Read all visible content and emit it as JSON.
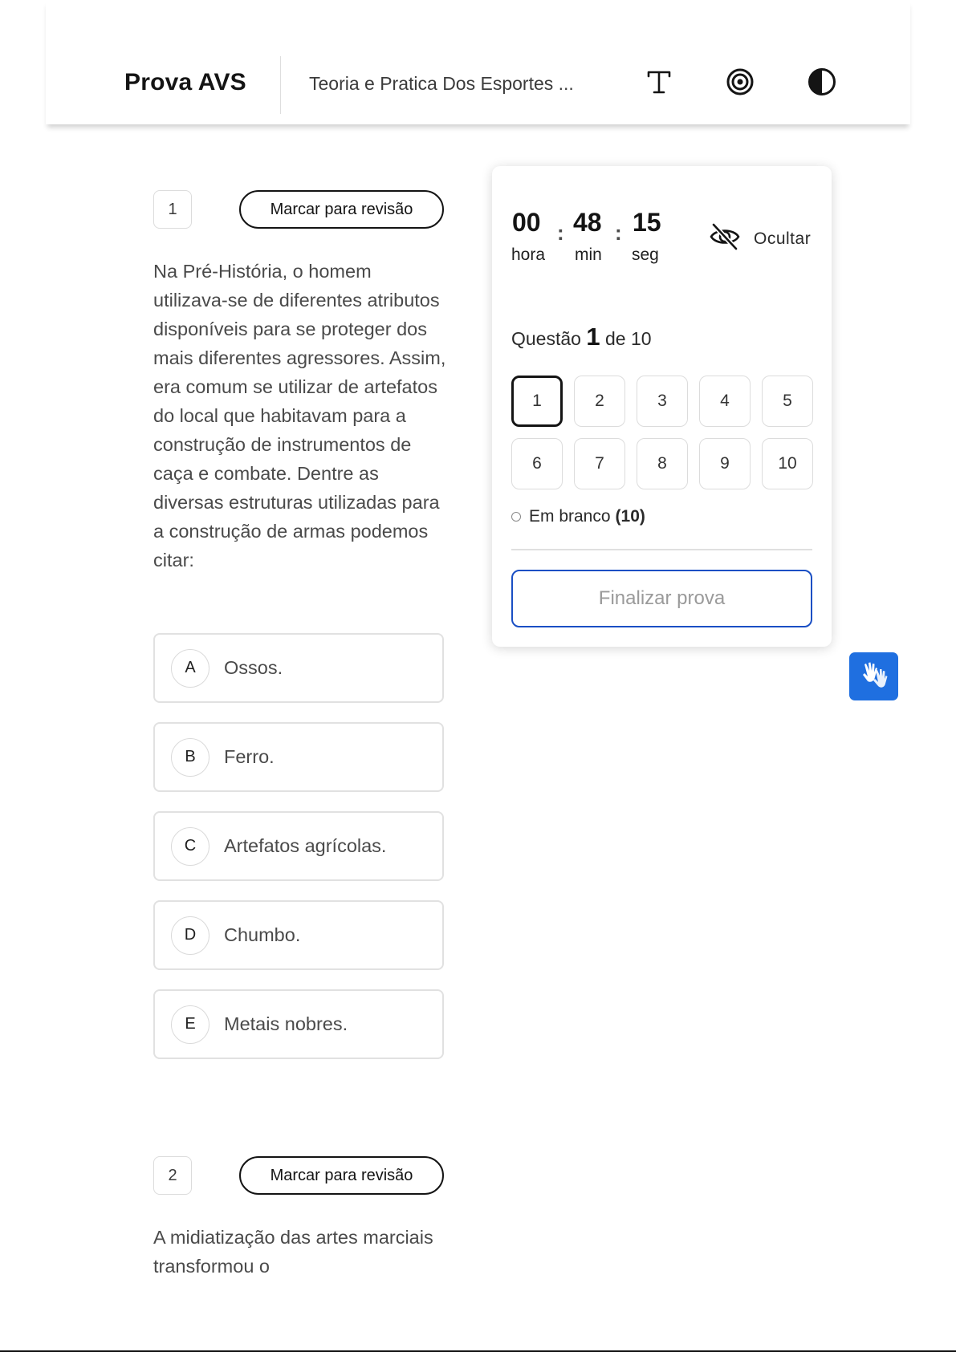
{
  "header": {
    "brand": "Prova AVS",
    "course_title": "Teoria e Pratica Dos Esportes ...",
    "icons": [
      "text-size-icon",
      "focus-target-icon",
      "contrast-icon"
    ]
  },
  "questions": [
    {
      "number": "1",
      "review_label": "Marcar para revisão",
      "text": "Na Pré-História, o homem utilizava-se de diferentes atributos disponíveis para se proteger dos mais diferentes agressores. Assim, era comum se utilizar de artefatos do local que habitavam para a construção de instrumentos de caça e combate. Dentre as diversas estruturas utilizadas para a construção de armas podemos citar:",
      "options": [
        {
          "letter": "A",
          "text": "Ossos."
        },
        {
          "letter": "B",
          "text": "Ferro."
        },
        {
          "letter": "C",
          "text": "Artefatos agrícolas."
        },
        {
          "letter": "D",
          "text": "Chumbo."
        },
        {
          "letter": "E",
          "text": "Metais nobres."
        }
      ]
    },
    {
      "number": "2",
      "review_label": "Marcar para revisão",
      "text": "A midiatização das artes marciais transformou o"
    }
  ],
  "timer": {
    "hours": "00",
    "minutes": "48",
    "seconds": "15",
    "hours_label": "hora",
    "minutes_label": "min",
    "seconds_label": "seg",
    "separator": ":",
    "hide_label": "Ocultar"
  },
  "navigator": {
    "prefix": "Questão",
    "current": "1",
    "suffix": "de 10",
    "items": [
      "1",
      "2",
      "3",
      "4",
      "5",
      "6",
      "7",
      "8",
      "9",
      "10"
    ],
    "blank_label": "Em branco",
    "blank_count": "(10)",
    "finish_label": "Finalizar prova"
  },
  "colors": {
    "accent_blue": "#1a4fc4",
    "libras_blue": "#1f6fe0"
  }
}
